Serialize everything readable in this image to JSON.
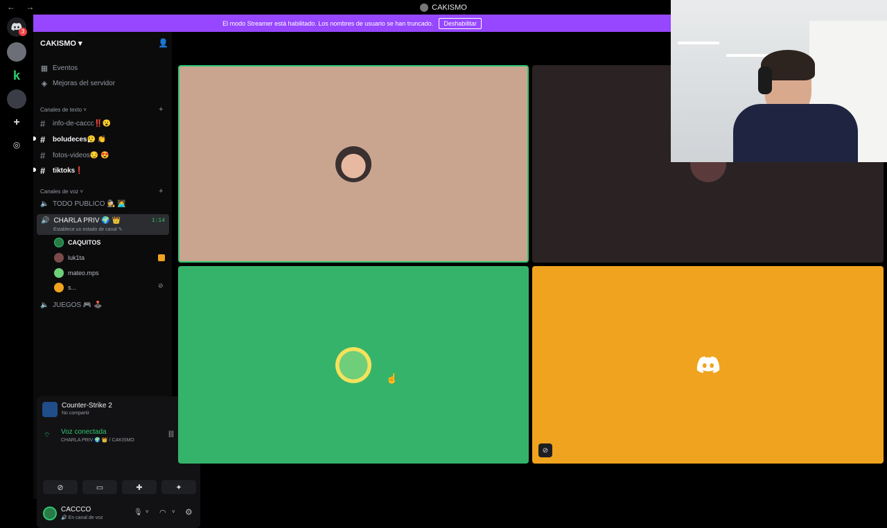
{
  "titlebar": {
    "nav": "← →",
    "title": "CAKISMO"
  },
  "servers": {
    "badge": "3",
    "icons": [
      "discord-home-icon",
      "server-icon",
      "server-icon",
      "server-icon",
      "add-server-icon",
      "discover-icon"
    ]
  },
  "banner": {
    "text": "El modo Streamer está habilitado. Los nombres de usuario se han truncado.",
    "button": "Deshabilitar"
  },
  "sidebar": {
    "server_name": "CAKISMO ▾",
    "top_items": [
      {
        "label": "Eventos"
      },
      {
        "label": "Mejoras del servidor"
      }
    ],
    "text_category": "Canales de texto ˅",
    "text_channels": [
      {
        "label": "info-de-caccc‼️😮"
      },
      {
        "label": "boludeces😮‍💨 👏"
      },
      {
        "label": "fotos-videos😏 😍"
      },
      {
        "label": "tiktoks❗"
      }
    ],
    "voice_category": "Canales de voz ˅",
    "voice_channels": [
      {
        "label": "TODO PUBLICO 🕵️ 🧑‍💻"
      },
      {
        "label": "CHARLA PRIV 🌍 👑",
        "time": "1:14",
        "status": "Establece un estado de canal ✎"
      },
      {
        "label": "JUEGOS 🎮 🕹️"
      }
    ],
    "voice_users": [
      {
        "name": "CAQUITOS"
      },
      {
        "name": "luk1ta"
      },
      {
        "name": "mateo.mps"
      },
      {
        "name": "s..."
      }
    ]
  },
  "panel": {
    "game": "Counter-Strike 2",
    "game_sub": "No compartir",
    "voice_status": "Voz conectada",
    "voice_channel": "CHARLA PRIV 🌍 👑 / CAKISMO",
    "username": "CACCCO",
    "user_status": "🔊 En canal de voz"
  },
  "colors": {
    "tile1": "#c9a590",
    "tile2": "#2b2223",
    "tile3": "#36b36a",
    "tile4": "#f0a31f",
    "banner": "#9747ff"
  }
}
